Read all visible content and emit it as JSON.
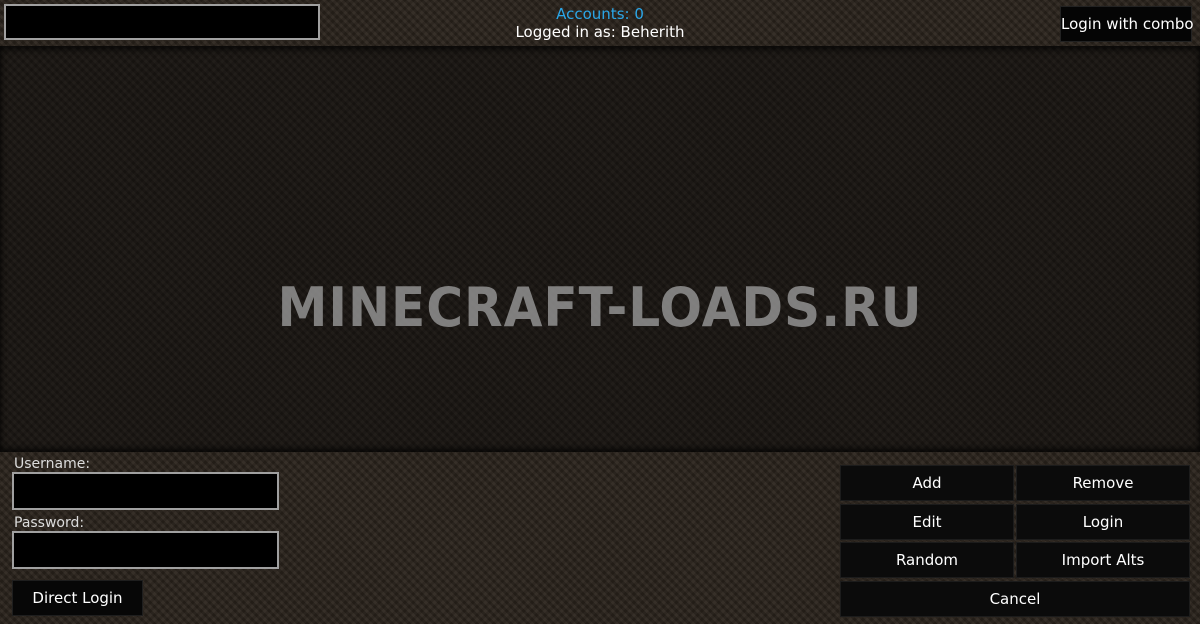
{
  "header": {
    "search": {
      "value": "",
      "placeholder": ""
    },
    "accounts_text": "Accounts: 0",
    "logged_in_text": "Logged in as: Beherith",
    "combo_button_label": "Login with combo"
  },
  "list": {
    "watermark_text": "MINECRAFT-LOADS.RU"
  },
  "login_form": {
    "username_label": "Username:",
    "username_value": "",
    "password_label": "Password:",
    "password_value": "",
    "direct_login_label": "Direct Login"
  },
  "actions": {
    "add": "Add",
    "remove": "Remove",
    "edit": "Edit",
    "login": "Login",
    "random": "Random",
    "import_alts": "Import Alts",
    "cancel": "Cancel"
  },
  "colors": {
    "accent": "#2ba6e8",
    "field_border": "#a0a0a0",
    "button_bg": "#0b0b0b"
  }
}
